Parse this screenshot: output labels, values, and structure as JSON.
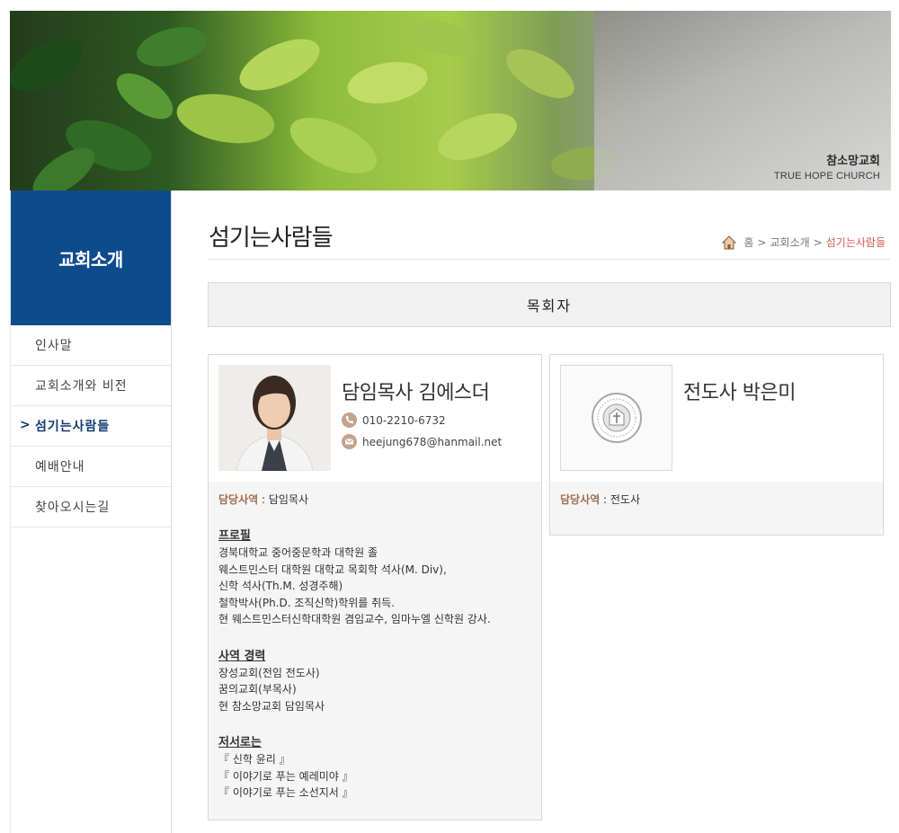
{
  "banner": {
    "title": "참소망교회",
    "subtitle": "TRUE HOPE CHURCH"
  },
  "sidebar": {
    "heading": "교회소개",
    "items": [
      {
        "label": "인사말",
        "active": false
      },
      {
        "label": "교회소개와 비전",
        "active": false
      },
      {
        "label": "섬기는사람들",
        "active": true
      },
      {
        "label": "예배안내",
        "active": false
      },
      {
        "label": "찾아오시는길",
        "active": false
      }
    ],
    "active_marker": ">"
  },
  "page": {
    "title": "섬기는사람들",
    "breadcrumb": {
      "home": "홈",
      "sep": ">",
      "level1": "교회소개",
      "current": "섬기는사람들"
    },
    "section_title": "목회자"
  },
  "pastor": {
    "name": "담임목사 김에스더",
    "phone": "010-2210-6732",
    "email": "heejung678@hanmail.net",
    "role_label": "담당사역",
    "role_sep": ":",
    "role_value": "담임목사",
    "profile_heading": "프로필",
    "profile": [
      "경북대학교 중어중문학과 대학원 졸",
      "웨스트민스터 대학원 대학교 목회학 석사(M. Div),",
      "신학 석사(Th.M. 성경주해)",
      "철학박사(Ph.D. 조직신학)학위를 취득.",
      "현 웨스트민스터신학대학원 겸임교수, 임마누엘 신학원 강사."
    ],
    "career_heading": "사역 경력",
    "career": [
      "장성교회(전임 전도사)",
      "꿈의교회(부목사)",
      "현 참소망교회 담임목사"
    ],
    "books_heading": "저서로는",
    "books": [
      "『 신학 윤리 』",
      "『 이야기로 푸는 예레미야 』",
      "『 이야기로 푸는 소선지서 』"
    ]
  },
  "evangelist": {
    "name": "전도사 박은미",
    "role_label": "담당사역",
    "role_sep": ":",
    "role_value": "전도사"
  },
  "colors": {
    "sidebar_head": "#0e4b8d",
    "breadcrumb_current": "#d0584e",
    "role_label": "#a06d4c",
    "contact_icon": "#c3a38e"
  },
  "icons": {
    "home": "home-icon",
    "phone": "phone-icon",
    "email": "mail-icon",
    "placeholder": "church-seal-icon"
  }
}
